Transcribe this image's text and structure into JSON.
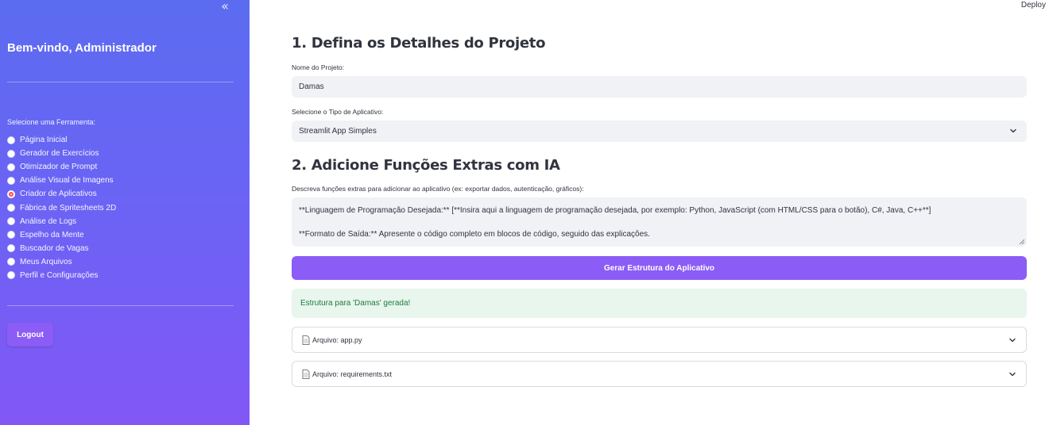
{
  "sidebar": {
    "collapse_icon": "double-chevron-left-icon",
    "collapse_glyph": "«",
    "welcome": "Bem-vindo, Administrador",
    "tool_label": "Selecione uma Ferramenta:",
    "tools": [
      {
        "label": "Página Inicial",
        "selected": false
      },
      {
        "label": "Gerador de Exercícios",
        "selected": false
      },
      {
        "label": "Otimizador de Prompt",
        "selected": false
      },
      {
        "label": "Análise Visual de Imagens",
        "selected": false
      },
      {
        "label": "Criador de Aplicativos",
        "selected": true
      },
      {
        "label": "Fábrica de Spritesheets 2D",
        "selected": false
      },
      {
        "label": "Análise de Logs",
        "selected": false
      },
      {
        "label": "Espelho da Mente",
        "selected": false
      },
      {
        "label": "Buscador de Vagas",
        "selected": false
      },
      {
        "label": "Meus Arquivos",
        "selected": false
      },
      {
        "label": "Perfil e Configurações",
        "selected": false
      }
    ],
    "logout_label": "Logout"
  },
  "topbar": {
    "deploy_label": "Deploy"
  },
  "main": {
    "section1_title": "1. Defina os Detalhes do Projeto",
    "project_name_label": "Nome do Projeto:",
    "project_name_value": "Damas",
    "app_type_label": "Selecione o Tipo de Aplicativo:",
    "app_type_value": "Streamlit App Simples",
    "section2_title": "2. Adicione Funções Extras com IA",
    "extras_label": "Descreva funções extras para adicionar ao aplicativo (ex: exportar dados, autenticação, gráficos):",
    "extras_line1": "**Linguagem de Programação Desejada:** [**Insira aqui a linguagem de programação desejada, por exemplo: Python, JavaScript (com HTML/CSS para o botão), C#, Java, C++**]",
    "extras_line2": "**Formato de Saída:** Apresente o código completo em blocos de código, seguido das explicações.",
    "generate_button": "Gerar Estrutura do Aplicativo",
    "success_message": "Estrutura para 'Damas' gerada!",
    "files": [
      {
        "icon": "file-icon",
        "label": "Arquivo: app.py"
      },
      {
        "icon": "file-icon",
        "label": "Arquivo: requirements.txt"
      }
    ]
  },
  "colors": {
    "sidebar_top": "#5b6cf0",
    "sidebar_bottom": "#8257f5",
    "accent": "#8b5cf6",
    "radio_selected": "#ff4b4b",
    "success_bg": "#e8f6ed",
    "success_text": "#1f7a3d"
  }
}
